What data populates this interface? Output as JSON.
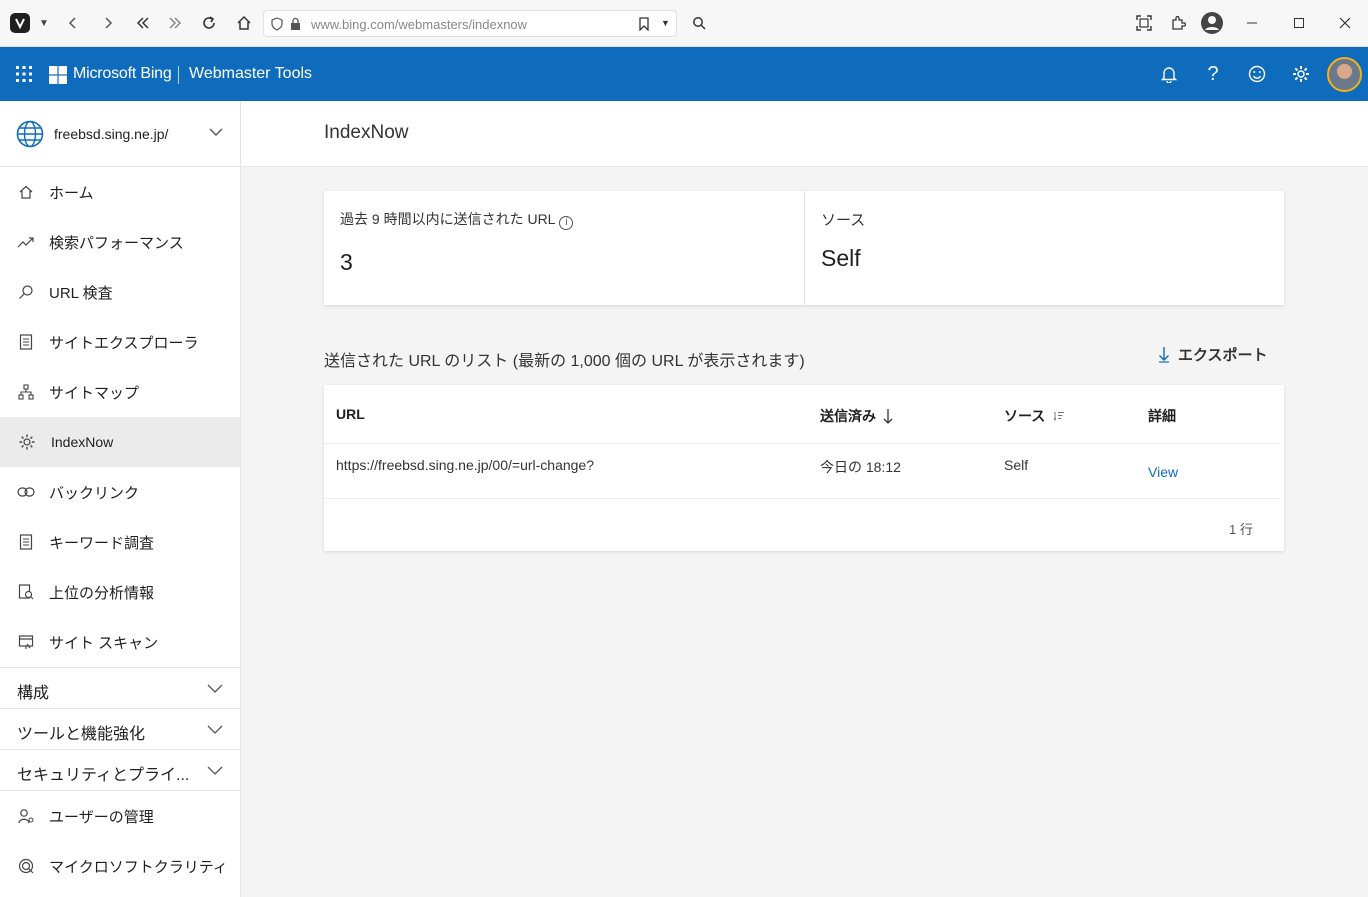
{
  "browser": {
    "url": "www.bing.com/webmasters/indexnow"
  },
  "header": {
    "brand": "Microsoft Bing",
    "product": "Webmaster Tools"
  },
  "sidebar": {
    "site": "freebsd.sing.ne.jp/",
    "items": [
      {
        "label": "ホーム",
        "icon": "home-icon"
      },
      {
        "label": "検索パフォーマンス",
        "icon": "trend-icon"
      },
      {
        "label": "URL 検査",
        "icon": "search-icon"
      },
      {
        "label": "サイトエクスプローラ",
        "icon": "document-icon"
      },
      {
        "label": "サイトマップ",
        "icon": "sitemap-icon"
      },
      {
        "label": "IndexNow",
        "icon": "gear-icon"
      },
      {
        "label": "バックリンク",
        "icon": "link-icon"
      },
      {
        "label": "キーワード調査",
        "icon": "document-icon"
      },
      {
        "label": "上位の分析情報",
        "icon": "insights-icon"
      },
      {
        "label": "サイト スキャン",
        "icon": "scan-icon"
      }
    ],
    "groups": [
      {
        "label": "構成"
      },
      {
        "label": "ツールと機能強化"
      },
      {
        "label": "セキュリティとプライ..."
      }
    ],
    "bottom_items": [
      {
        "label": "ユーザーの管理",
        "icon": "user-icon"
      },
      {
        "label": "マイクロソフトクラリティ",
        "icon": "clarity-icon"
      }
    ],
    "active_index": 5
  },
  "main": {
    "title": "IndexNow",
    "stats": {
      "submitted_label": "過去 9 時間以内に送信された URL",
      "submitted_value": "3",
      "source_label": "ソース",
      "source_value": "Self"
    },
    "list_title": "送信された URL のリスト (最新の 1,000 個の URL が表示されます)",
    "export_label": "エクスポート",
    "table": {
      "headers": [
        "URL",
        "送信済み",
        "ソース",
        "詳細"
      ],
      "rows": [
        {
          "url": "https://freebsd.sing.ne.jp/00/=url-change?",
          "submitted": "今日の 18:12",
          "source": "Self",
          "details": "View"
        }
      ],
      "row_count": "1 行"
    }
  },
  "colors": {
    "accent": "#0f6cbd",
    "active_nav": "#ebebeb"
  }
}
